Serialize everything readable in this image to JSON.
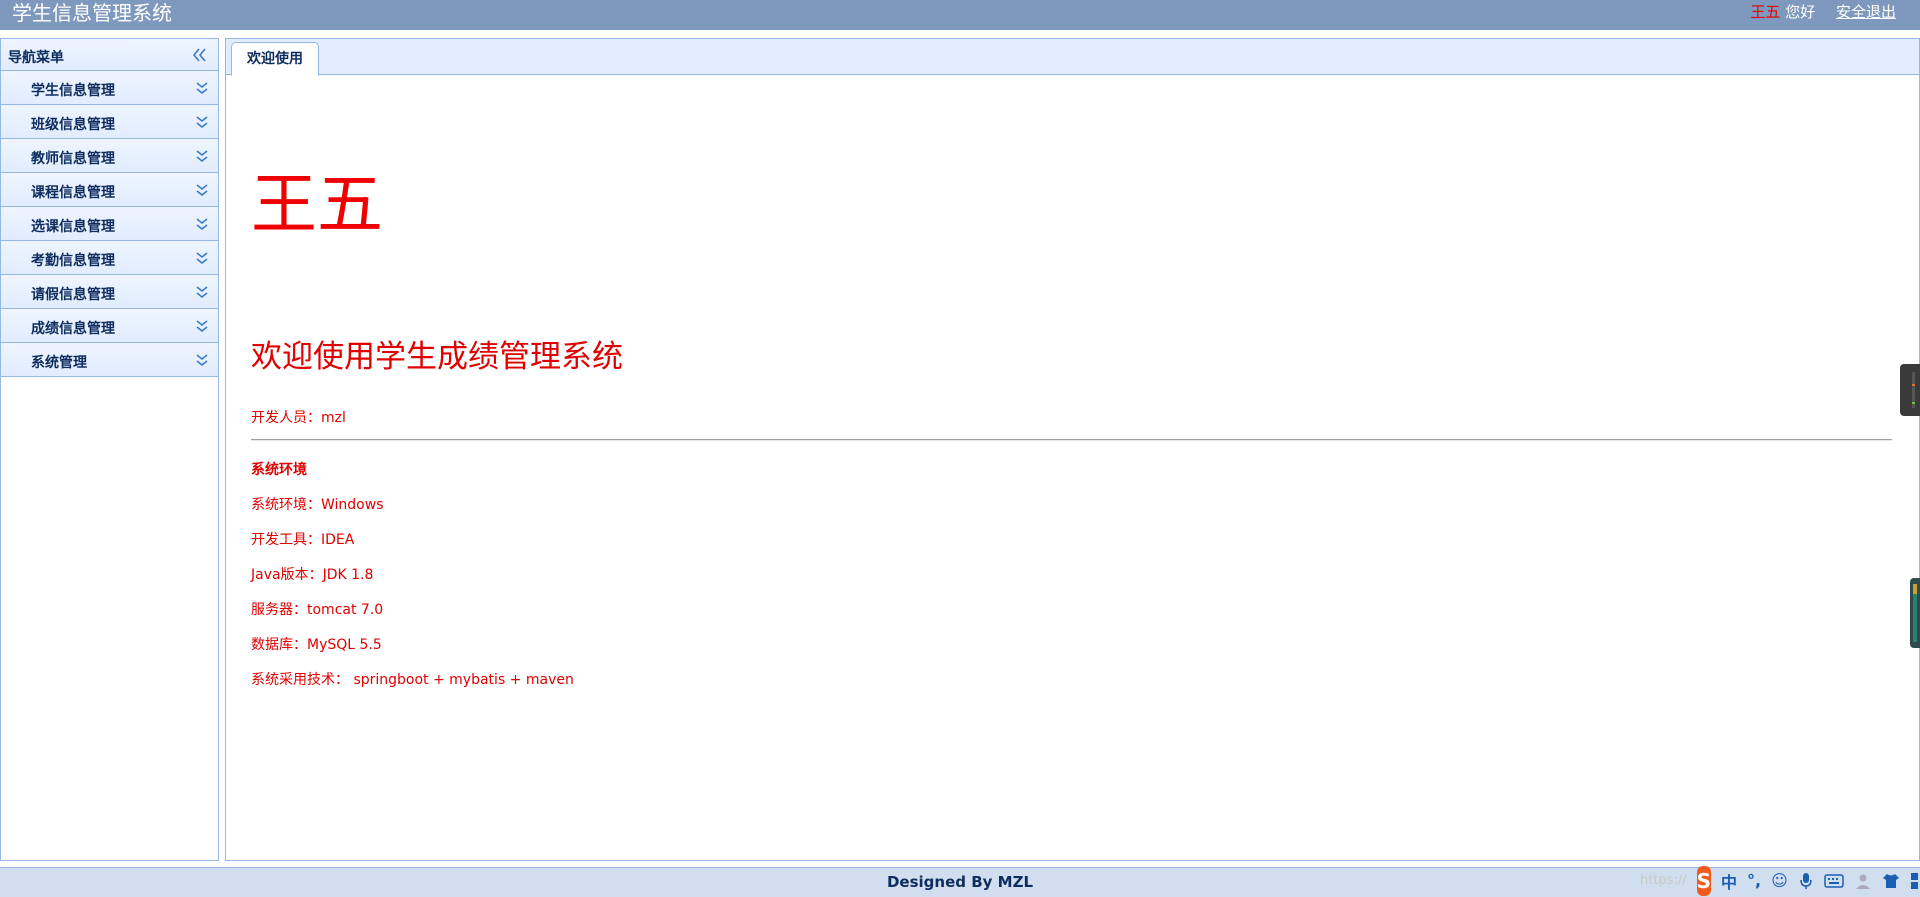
{
  "header": {
    "app_title": "学生信息管理系统",
    "user_name": "王五",
    "greeting": "您好",
    "logout_label": "安全退出"
  },
  "sidebar": {
    "title": "导航菜单",
    "items": [
      {
        "label": "学生信息管理"
      },
      {
        "label": "班级信息管理"
      },
      {
        "label": "教师信息管理"
      },
      {
        "label": "课程信息管理"
      },
      {
        "label": "选课信息管理"
      },
      {
        "label": "考勤信息管理"
      },
      {
        "label": "请假信息管理"
      },
      {
        "label": "成绩信息管理"
      },
      {
        "label": "系统管理"
      }
    ]
  },
  "tabs": [
    {
      "label": "欢迎使用"
    }
  ],
  "content": {
    "user_name": "王五",
    "welcome": "欢迎使用学生成绩管理系统",
    "developer": "开发人员：mzl",
    "env_heading": "系统环境",
    "env_lines": [
      "系统环境：Windows",
      "开发工具：IDEA",
      "Java版本：JDK 1.8",
      "服务器：tomcat 7.0",
      "数据库：MySQL 5.5",
      "系统采用技术： springboot + mybatis + maven"
    ]
  },
  "footer": {
    "text": "Designed By MZL"
  },
  "ime": {
    "mode_label": "中",
    "watermark": "https://"
  },
  "colors": {
    "header_bg": "#7f99be",
    "accent_red": "#e00000",
    "panel_border": "#95b8e7",
    "nav_text": "#0e2d5f"
  }
}
